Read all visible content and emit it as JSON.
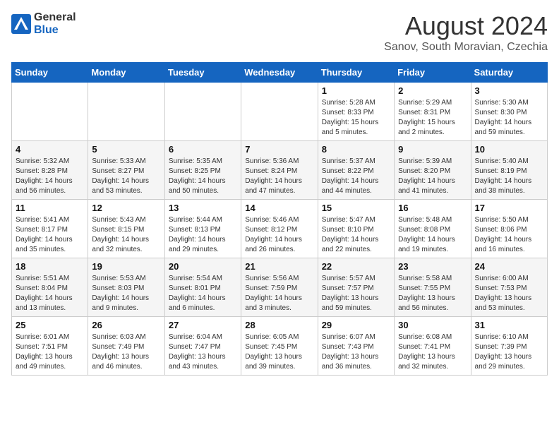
{
  "header": {
    "logo_general": "General",
    "logo_blue": "Blue",
    "month_year": "August 2024",
    "location": "Sanov, South Moravian, Czechia"
  },
  "days_of_week": [
    "Sunday",
    "Monday",
    "Tuesday",
    "Wednesday",
    "Thursday",
    "Friday",
    "Saturday"
  ],
  "weeks": [
    [
      {
        "day": "",
        "info": ""
      },
      {
        "day": "",
        "info": ""
      },
      {
        "day": "",
        "info": ""
      },
      {
        "day": "",
        "info": ""
      },
      {
        "day": "1",
        "info": "Sunrise: 5:28 AM\nSunset: 8:33 PM\nDaylight: 15 hours\nand 5 minutes."
      },
      {
        "day": "2",
        "info": "Sunrise: 5:29 AM\nSunset: 8:31 PM\nDaylight: 15 hours\nand 2 minutes."
      },
      {
        "day": "3",
        "info": "Sunrise: 5:30 AM\nSunset: 8:30 PM\nDaylight: 14 hours\nand 59 minutes."
      }
    ],
    [
      {
        "day": "4",
        "info": "Sunrise: 5:32 AM\nSunset: 8:28 PM\nDaylight: 14 hours\nand 56 minutes."
      },
      {
        "day": "5",
        "info": "Sunrise: 5:33 AM\nSunset: 8:27 PM\nDaylight: 14 hours\nand 53 minutes."
      },
      {
        "day": "6",
        "info": "Sunrise: 5:35 AM\nSunset: 8:25 PM\nDaylight: 14 hours\nand 50 minutes."
      },
      {
        "day": "7",
        "info": "Sunrise: 5:36 AM\nSunset: 8:24 PM\nDaylight: 14 hours\nand 47 minutes."
      },
      {
        "day": "8",
        "info": "Sunrise: 5:37 AM\nSunset: 8:22 PM\nDaylight: 14 hours\nand 44 minutes."
      },
      {
        "day": "9",
        "info": "Sunrise: 5:39 AM\nSunset: 8:20 PM\nDaylight: 14 hours\nand 41 minutes."
      },
      {
        "day": "10",
        "info": "Sunrise: 5:40 AM\nSunset: 8:19 PM\nDaylight: 14 hours\nand 38 minutes."
      }
    ],
    [
      {
        "day": "11",
        "info": "Sunrise: 5:41 AM\nSunset: 8:17 PM\nDaylight: 14 hours\nand 35 minutes."
      },
      {
        "day": "12",
        "info": "Sunrise: 5:43 AM\nSunset: 8:15 PM\nDaylight: 14 hours\nand 32 minutes."
      },
      {
        "day": "13",
        "info": "Sunrise: 5:44 AM\nSunset: 8:13 PM\nDaylight: 14 hours\nand 29 minutes."
      },
      {
        "day": "14",
        "info": "Sunrise: 5:46 AM\nSunset: 8:12 PM\nDaylight: 14 hours\nand 26 minutes."
      },
      {
        "day": "15",
        "info": "Sunrise: 5:47 AM\nSunset: 8:10 PM\nDaylight: 14 hours\nand 22 minutes."
      },
      {
        "day": "16",
        "info": "Sunrise: 5:48 AM\nSunset: 8:08 PM\nDaylight: 14 hours\nand 19 minutes."
      },
      {
        "day": "17",
        "info": "Sunrise: 5:50 AM\nSunset: 8:06 PM\nDaylight: 14 hours\nand 16 minutes."
      }
    ],
    [
      {
        "day": "18",
        "info": "Sunrise: 5:51 AM\nSunset: 8:04 PM\nDaylight: 14 hours\nand 13 minutes."
      },
      {
        "day": "19",
        "info": "Sunrise: 5:53 AM\nSunset: 8:03 PM\nDaylight: 14 hours\nand 9 minutes."
      },
      {
        "day": "20",
        "info": "Sunrise: 5:54 AM\nSunset: 8:01 PM\nDaylight: 14 hours\nand 6 minutes."
      },
      {
        "day": "21",
        "info": "Sunrise: 5:56 AM\nSunset: 7:59 PM\nDaylight: 14 hours\nand 3 minutes."
      },
      {
        "day": "22",
        "info": "Sunrise: 5:57 AM\nSunset: 7:57 PM\nDaylight: 13 hours\nand 59 minutes."
      },
      {
        "day": "23",
        "info": "Sunrise: 5:58 AM\nSunset: 7:55 PM\nDaylight: 13 hours\nand 56 minutes."
      },
      {
        "day": "24",
        "info": "Sunrise: 6:00 AM\nSunset: 7:53 PM\nDaylight: 13 hours\nand 53 minutes."
      }
    ],
    [
      {
        "day": "25",
        "info": "Sunrise: 6:01 AM\nSunset: 7:51 PM\nDaylight: 13 hours\nand 49 minutes."
      },
      {
        "day": "26",
        "info": "Sunrise: 6:03 AM\nSunset: 7:49 PM\nDaylight: 13 hours\nand 46 minutes."
      },
      {
        "day": "27",
        "info": "Sunrise: 6:04 AM\nSunset: 7:47 PM\nDaylight: 13 hours\nand 43 minutes."
      },
      {
        "day": "28",
        "info": "Sunrise: 6:05 AM\nSunset: 7:45 PM\nDaylight: 13 hours\nand 39 minutes."
      },
      {
        "day": "29",
        "info": "Sunrise: 6:07 AM\nSunset: 7:43 PM\nDaylight: 13 hours\nand 36 minutes."
      },
      {
        "day": "30",
        "info": "Sunrise: 6:08 AM\nSunset: 7:41 PM\nDaylight: 13 hours\nand 32 minutes."
      },
      {
        "day": "31",
        "info": "Sunrise: 6:10 AM\nSunset: 7:39 PM\nDaylight: 13 hours\nand 29 minutes."
      }
    ]
  ]
}
